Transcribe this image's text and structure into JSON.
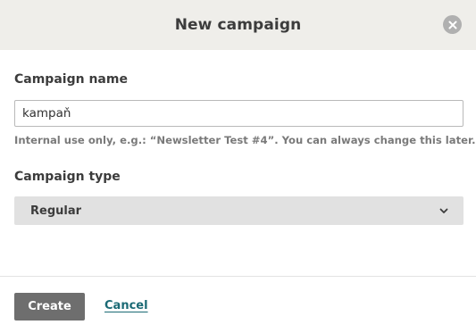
{
  "dialog": {
    "title": "New campaign",
    "close_icon": "close-circle-icon"
  },
  "campaign_name": {
    "label": "Campaign name",
    "value": "kampaň",
    "help_text": "Internal use only, e.g.: “Newsletter Test #4”. You can always change this later."
  },
  "campaign_type": {
    "label": "Campaign type",
    "selected": "Regular",
    "icon": "chevron-down-icon"
  },
  "footer": {
    "create_label": "Create",
    "cancel_label": "Cancel"
  },
  "colors": {
    "header_bg": "#efeeea",
    "primary_button": "#6e6e6e",
    "link": "#1b6a75",
    "select_bg": "#e1e1e1"
  }
}
